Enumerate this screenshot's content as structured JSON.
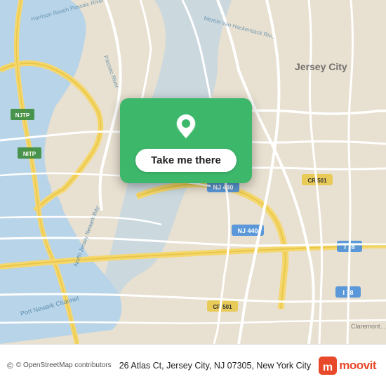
{
  "map": {
    "background_color": "#e8e0d0",
    "accent_green": "#3db86b",
    "water_color": "#b8d4e8",
    "road_yellow": "#f5d76e",
    "road_white": "#ffffff"
  },
  "callout": {
    "button_label": "Take me there",
    "pin_color": "#ffffff",
    "background_color": "#3db86b"
  },
  "bottom_bar": {
    "osm_credit": "© OpenStreetMap contributors",
    "address": "26 Atlas Ct, Jersey City, NJ 07305, New York City",
    "logo_text": "moovit"
  }
}
